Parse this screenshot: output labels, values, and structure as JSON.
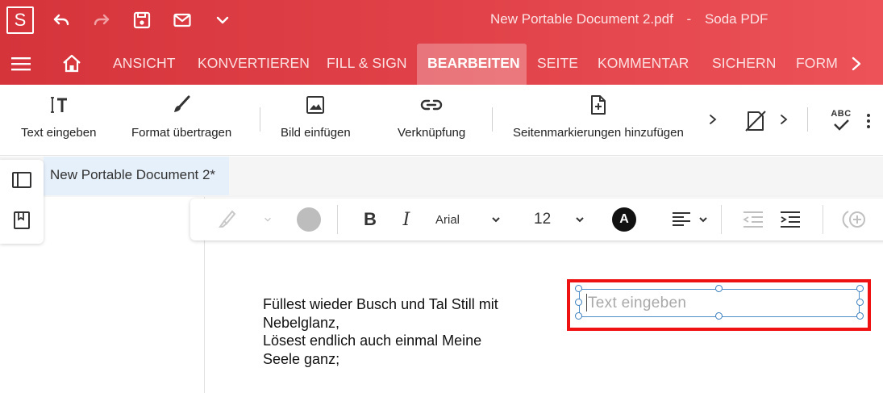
{
  "app": {
    "logo_letter": "S",
    "document_name": "New Portable Document 2.pdf",
    "separator": "-",
    "app_name": "Soda PDF"
  },
  "quick_access": [
    {
      "name": "undo-icon"
    },
    {
      "name": "redo-icon"
    },
    {
      "name": "save-icon"
    },
    {
      "name": "mail-icon"
    },
    {
      "name": "chevron-down-icon"
    }
  ],
  "menu_tabs": [
    {
      "label": "ANSICHT",
      "active": false
    },
    {
      "label": "KONVERTIEREN",
      "active": false
    },
    {
      "label": "FILL & SIGN",
      "active": false
    },
    {
      "label": "BEARBEITEN",
      "active": true
    },
    {
      "label": "SEITE",
      "active": false
    },
    {
      "label": "KOMMENTAR",
      "active": false
    },
    {
      "label": "SICHERN",
      "active": false
    },
    {
      "label": "FORM",
      "active": false
    }
  ],
  "ribbon": {
    "text_insert": "Text eingeben",
    "format_painter": "Format übertragen",
    "image_insert": "Bild einfügen",
    "link": "Verknüpfung",
    "page_marks": "Seitenmarkierungen hinzufügen",
    "spellcheck_icon_text": "ABC"
  },
  "doc_tab": {
    "label": "New Portable Document 2*"
  },
  "format_toolbar": {
    "font": "Arial",
    "font_size": "12",
    "text_color_letter": "A"
  },
  "document": {
    "lines": [
      "Füllest wieder Busch und Tal Still mit",
      "Nebelglanz,",
      "Lösest endlich auch einmal Meine",
      "Seele ganz;"
    ],
    "field_placeholder": "Text eingeben"
  },
  "colors": {
    "brand_red": "#e2434a",
    "highlight_red": "#ee1212",
    "selection_blue": "#4e8fc9"
  }
}
